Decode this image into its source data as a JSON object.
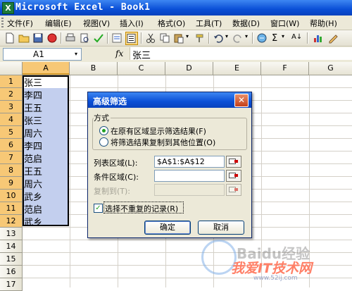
{
  "window": {
    "title": "Microsoft Excel - Book1",
    "app_icon": "X"
  },
  "menu": [
    "文件(F)",
    "编辑(E)",
    "视图(V)",
    "插入(I)",
    "格式(O)",
    "工具(T)",
    "数据(D)",
    "窗口(W)",
    "帮助(H)"
  ],
  "toolbar": {
    "sigma": "Σ",
    "sort_label": "A↓",
    "zoom_dropdown": "▾"
  },
  "formula_bar": {
    "name_box": "A1",
    "fx_label": "fx",
    "value": "张三"
  },
  "columns": [
    "A",
    "B",
    "C",
    "D",
    "E",
    "F",
    "G"
  ],
  "rows": [
    "1",
    "2",
    "3",
    "4",
    "5",
    "6",
    "7",
    "8",
    "9",
    "10",
    "11",
    "12",
    "13",
    "14",
    "15",
    "16",
    "17"
  ],
  "column_a_values": [
    "张三",
    "李四",
    "王五",
    "张三",
    "周六",
    "李四",
    "范启",
    "王五",
    "周六",
    "武乡",
    "范启",
    "武乡"
  ],
  "dialog": {
    "title": "高级筛选",
    "close": "✕",
    "group_label": "方式",
    "option_in_place": "在原有区域显示筛选结果(F)",
    "option_copy": "将筛选结果复制到其他位置(O)",
    "list_range_label": "列表区域(L):",
    "list_range_value": "$A$1:$A$12",
    "criteria_label": "条件区域(C):",
    "criteria_value": "",
    "copy_to_label": "复制到(T):",
    "copy_to_value": "",
    "unique_label": "选择不重复的记录(R)",
    "unique_checked": "✓",
    "ok": "确定",
    "cancel": "取消"
  },
  "watermark": {
    "line1": "Baidu经验",
    "line2": "我爱IT技术网",
    "line3": "www.52ij.com"
  }
}
